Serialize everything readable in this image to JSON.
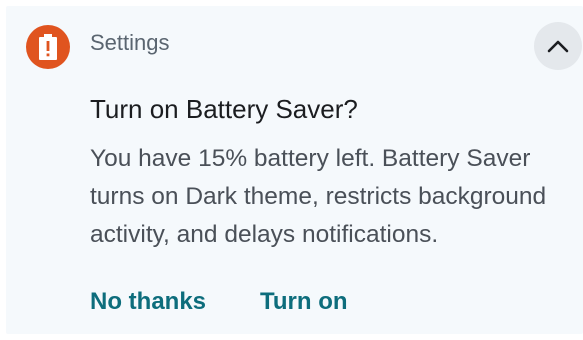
{
  "notification": {
    "app_name": "Settings",
    "app_icon": "alert-icon",
    "app_icon_color": "#e0541f",
    "collapse_icon": "chevron-up-icon",
    "title": "Turn on Battery Saver?",
    "message": "You have 15% battery left. Battery Saver turns on Dark theme, restricts background activity, and delays notifications.",
    "actions": {
      "dismiss_label": "No thanks",
      "confirm_label": "Turn on"
    },
    "accent_color": "#0d6d7c",
    "background_color": "#f5f9fc"
  }
}
